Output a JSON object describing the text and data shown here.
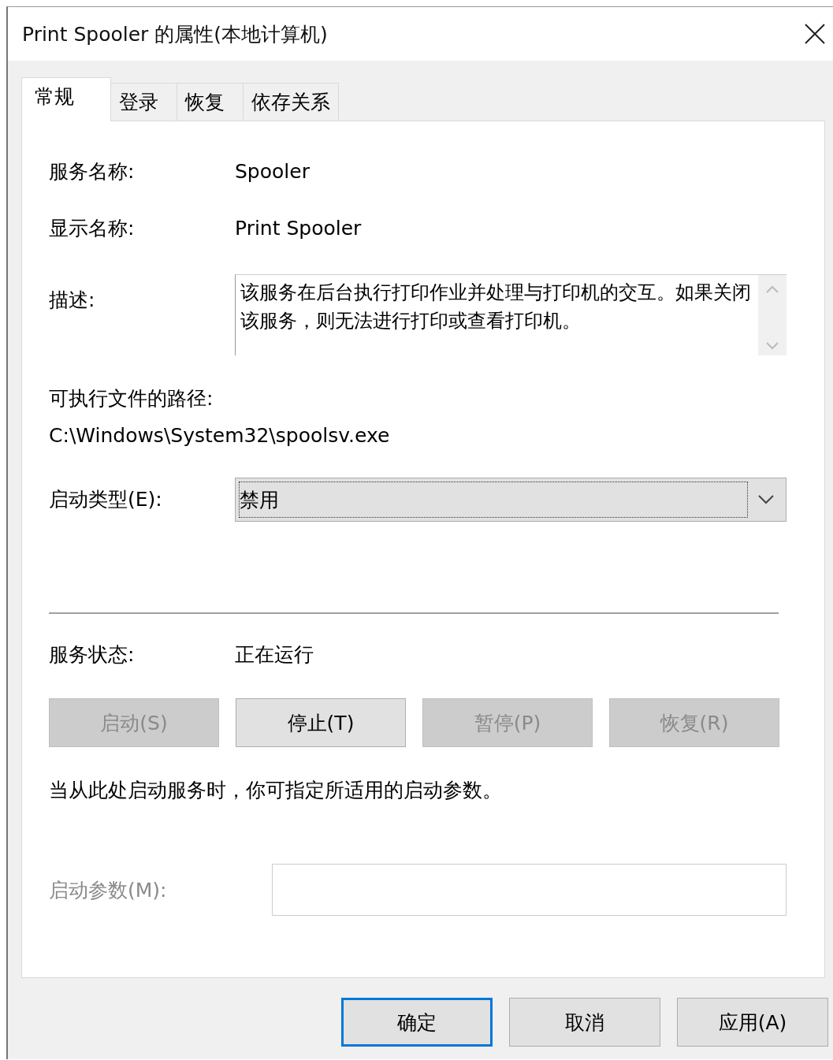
{
  "window": {
    "title": "Print Spooler 的属性(本地计算机)"
  },
  "tabs": [
    {
      "label": "常规",
      "selected": true
    },
    {
      "label": "登录",
      "selected": false
    },
    {
      "label": "恢复",
      "selected": false
    },
    {
      "label": "依存关系",
      "selected": false
    }
  ],
  "service_name": {
    "label": "服务名称:",
    "value": "Spooler"
  },
  "display_name": {
    "label": "显示名称:",
    "value": "Print Spooler"
  },
  "description": {
    "label": "描述:",
    "value": "该服务在后台执行打印作业并处理与打印机的交互。如果关闭该服务，则无法进行打印或查看打印机。"
  },
  "executable_path": {
    "label": "可执行文件的路径:",
    "value": "C:\\Windows\\System32\\spoolsv.exe"
  },
  "startup_type": {
    "label": "启动类型(E):",
    "value": "禁用",
    "focused": true
  },
  "service_status": {
    "label": "服务状态:",
    "value": "正在运行"
  },
  "service_buttons": [
    {
      "label": "启动(S)",
      "disabled": true
    },
    {
      "label": "停止(T)",
      "disabled": false
    },
    {
      "label": "暂停(P)",
      "disabled": true
    },
    {
      "label": "恢复(R)",
      "disabled": true
    }
  ],
  "hint": "当从此处启动服务时，你可指定所适用的启动参数。",
  "start_parameters": {
    "label": "启动参数(M):",
    "disabled": true
  },
  "buttons": [
    {
      "label": "确定",
      "default": true
    },
    {
      "label": "取消",
      "default": false
    },
    {
      "label": "应用(A)",
      "default": false
    }
  ]
}
